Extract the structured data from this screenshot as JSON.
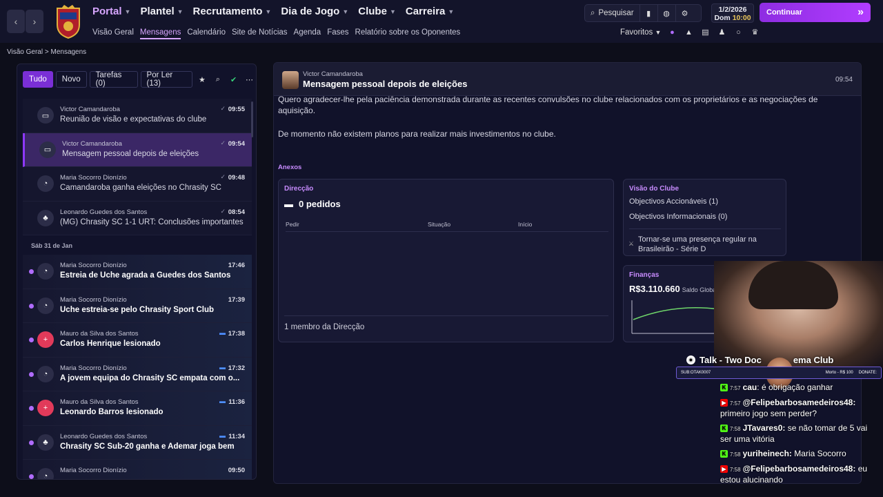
{
  "nav": {
    "back": "‹",
    "forward": "›",
    "main": [
      {
        "label": "Portal",
        "active": true
      },
      {
        "label": "Plantel"
      },
      {
        "label": "Recrutamento"
      },
      {
        "label": "Dia de Jogo"
      },
      {
        "label": "Clube"
      },
      {
        "label": "Carreira"
      }
    ],
    "sub": [
      "Visão Geral",
      "Mensagens",
      "Calendário",
      "Site de Notícias",
      "Agenda",
      "Fases",
      "Relatório sobre os Oponentes"
    ],
    "search_label": "Pesquisar",
    "date": "1/2/2026",
    "day": "Dom",
    "time": "10:00",
    "continue_label": "Continuar",
    "favorites_label": "Favoritos"
  },
  "breadcrumb": {
    "root": "Visão Geral",
    "sep": ">",
    "current": "Mensagens"
  },
  "filters": {
    "all": "Tudo",
    "new": "Novo",
    "tasks": "Tarefas (0)",
    "unread": "Por Ler (13)"
  },
  "messages_today": [
    {
      "sender": "Victor Camandaroba",
      "subject": "Reunião de visão e expectativas do clube",
      "time": "09:55",
      "icon": "briefcase-icon"
    },
    {
      "sender": "Victor Camandaroba",
      "subject": "Mensagem pessoal depois de eleições",
      "time": "09:54",
      "icon": "briefcase-icon",
      "selected": true
    },
    {
      "sender": "Maria Socorro Dionízio",
      "subject": "Camandaroba ganha eleições no Chrasity SC",
      "time": "09:48",
      "icon": "scout-icon"
    },
    {
      "sender": "Leonardo Guedes dos Santos",
      "subject": "(MG) Chrasity SC 1-1 URT: Conclusões importantes",
      "time": "08:54",
      "icon": "team-icon"
    }
  ],
  "day_header": "Sáb 31 de Jan",
  "messages_prev": [
    {
      "sender": "Maria Socorro Dionízio",
      "subject": "Estreia de Uche agrada a Guedes dos Santos",
      "time": "17:46"
    },
    {
      "sender": "Maria Socorro Dionízio",
      "subject": "Uche estreia-se pelo Chrasity Sport Club",
      "time": "17:39"
    },
    {
      "sender": "Mauro da Silva dos Santos",
      "subject": "Carlos Henrique lesionado",
      "time": "17:38"
    },
    {
      "sender": "Maria Socorro Dionízio",
      "subject": "A jovem equipa do Chrasity SC empata com o...",
      "time": "17:32"
    },
    {
      "sender": "Mauro da Silva dos Santos",
      "subject": "Leonardo Barros lesionado",
      "time": "11:36"
    },
    {
      "sender": "Leonardo Guedes dos Santos",
      "subject": "Chrasity SC Sub-20 ganha e Ademar joga bem",
      "time": "11:34"
    },
    {
      "sender": "Maria Socorro Dionízio",
      "subject": "",
      "time": "09:50"
    }
  ],
  "message": {
    "from": "Victor Camandaroba",
    "title": "Mensagem pessoal depois de eleições",
    "time": "09:54",
    "para1": "Quero agradecer-lhe pela paciência demonstrada durante as recentes convulsões no clube relacionados com os proprietários e as negociações de aquisição.",
    "para2": "De momento não existem planos para realizar mais investimentos no clube.",
    "attachments_label": "Anexos"
  },
  "direcao": {
    "title": "Direcção",
    "pedidos": "0 pedidos",
    "col_pedir": "Pedir",
    "col_situacao": "Situação",
    "col_inicio": "Início",
    "membro": "1 membro da Direcção"
  },
  "visao": {
    "title": "Visão do Clube",
    "accionaveis": "Objectivos Accionáveis (1)",
    "informacionais": "Objectivos Informacionais (0)",
    "goal": "Tornar-se uma presença regular na Brasileirão - Série D"
  },
  "financas": {
    "title": "Finanças",
    "amount": "R$3.110.660",
    "amount_label": "Saldo Global"
  },
  "overlay": {
    "title": "Talk - Two Doc",
    "title2": "ema Club",
    "bar_left": "SUB:",
    "bar_mid": "OTAK0007",
    "bar_right": "Morto - R$ 100",
    "bar_end": "DONATE:"
  },
  "chat": [
    {
      "platform": "k",
      "time": "7:57",
      "user": "cau",
      "text": "é obrigação ganhar"
    },
    {
      "platform": "y",
      "time": "7:57",
      "user": "@Felipebarbosamedeiros48:",
      "text": "primeiro jogo sem perder?"
    },
    {
      "platform": "k",
      "time": "7:58",
      "user": "JTavares0:",
      "text": "se não tomar de 5 vai ser uma vitória"
    },
    {
      "platform": "k",
      "time": "7:58",
      "user": "yuriheinech:",
      "text": "Maria Socorro"
    },
    {
      "platform": "y",
      "time": "7:58",
      "user": "@Felipebarbosamedeiros48:",
      "text": "eu estou alucinando"
    }
  ]
}
